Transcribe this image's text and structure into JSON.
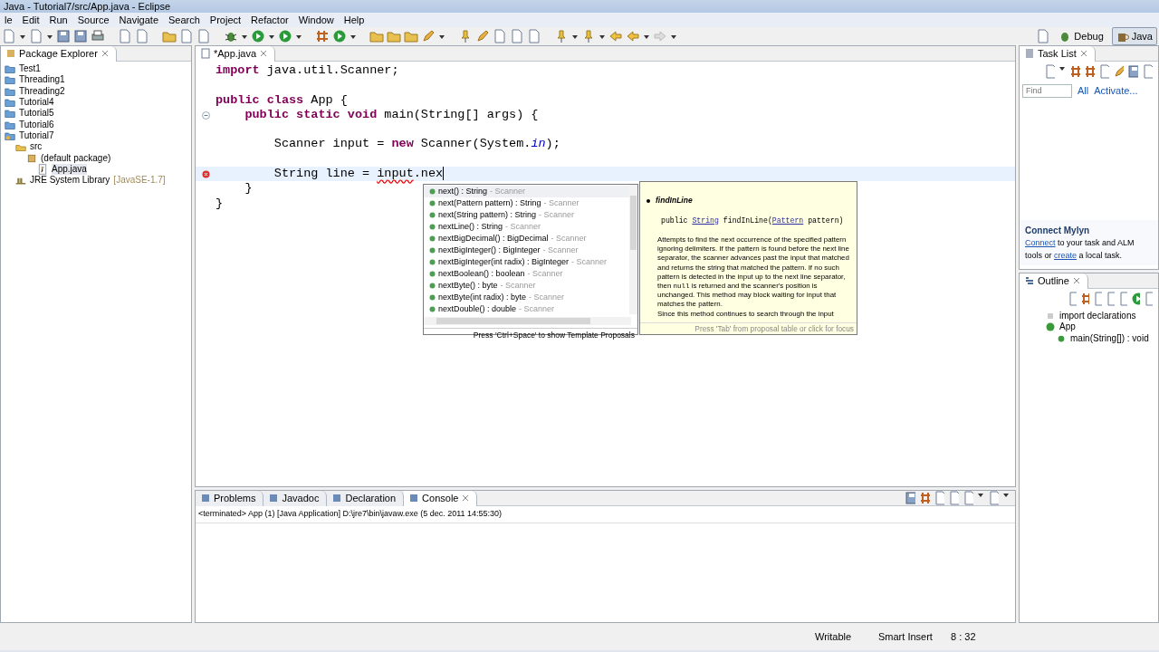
{
  "window": {
    "title": "Java - Tutorial7/src/App.java - Eclipse"
  },
  "menu": [
    "le",
    "Edit",
    "Run",
    "Source",
    "Navigate",
    "Search",
    "Project",
    "Refactor",
    "Window",
    "Help"
  ],
  "perspectives": [
    {
      "label": "Debug",
      "selected": false
    },
    {
      "label": "Java",
      "selected": true
    }
  ],
  "package_explorer": {
    "title": "Package Explorer",
    "tree": [
      {
        "label": "Test1",
        "kind": "project"
      },
      {
        "label": "Threading1",
        "kind": "project"
      },
      {
        "label": "Threading2",
        "kind": "project"
      },
      {
        "label": "Tutorial4",
        "kind": "project"
      },
      {
        "label": "Tutorial5",
        "kind": "project"
      },
      {
        "label": "Tutorial6",
        "kind": "project"
      },
      {
        "label": "Tutorial7",
        "kind": "javaproject",
        "children": [
          {
            "label": "src",
            "kind": "src",
            "children": [
              {
                "label": "(default package)",
                "kind": "package",
                "children": [
                  {
                    "label": "App.java",
                    "kind": "file",
                    "selected": true
                  }
                ]
              }
            ]
          },
          {
            "label": "JRE System Library",
            "decoration": "[JavaSE-1.7]",
            "kind": "library"
          }
        ]
      }
    ]
  },
  "editor": {
    "tab": {
      "label": "*App.java",
      "selected": true
    },
    "lines": [
      {
        "tokens": [
          {
            "text": "import",
            "kind": "keyword"
          },
          {
            "text": " java.util.Scanner;",
            "kind": "plain"
          }
        ]
      },
      {
        "blank": true
      },
      {
        "tokens": [
          {
            "text": "public class",
            "kind": "keyword"
          },
          {
            "text": " App {",
            "kind": "plain"
          }
        ]
      },
      {
        "foldable": true,
        "tokens": [
          {
            "text": "    public static void",
            "kind": "keyword"
          },
          {
            "text": " main(String[] args) {",
            "kind": "plain"
          }
        ]
      },
      {
        "blank": true
      },
      {
        "tokens": [
          {
            "text": "        Scanner input = ",
            "kind": "plain"
          },
          {
            "text": "new",
            "kind": "keyword"
          },
          {
            "text": " Scanner(System.",
            "kind": "plain"
          },
          {
            "text": "in",
            "kind": "static"
          },
          {
            "text": ");",
            "kind": "plain"
          }
        ]
      },
      {
        "blank": true
      },
      {
        "error": true,
        "current": true,
        "cursor": true,
        "tokens": [
          {
            "text": "        String line = ",
            "kind": "plain"
          },
          {
            "text": "input",
            "kind": "error"
          },
          {
            "text": ".nex",
            "kind": "plain"
          }
        ]
      },
      {
        "tokens": [
          {
            "text": "    }",
            "kind": "plain"
          }
        ]
      },
      {
        "tokens": [
          {
            "text": "}",
            "kind": "plain"
          }
        ]
      }
    ]
  },
  "completion": {
    "items": [
      {
        "signature": "next() : String",
        "owner": "- Scanner",
        "selected": true
      },
      {
        "signature": "next(Pattern pattern) : String",
        "owner": "- Scanner",
        "selected": false
      },
      {
        "signature": "next(String pattern) : String",
        "owner": "- Scanner",
        "selected": false
      },
      {
        "signature": "nextLine() : String",
        "owner": "- Scanner",
        "selected": false
      },
      {
        "signature": "nextBigDecimal() : BigDecimal",
        "owner": "- Scanner",
        "selected": false
      },
      {
        "signature": "nextBigInteger() : BigInteger",
        "owner": "- Scanner",
        "selected": false
      },
      {
        "signature": "nextBigInteger(int radix) : BigInteger",
        "owner": "- Scanner",
        "selected": false
      },
      {
        "signature": "nextBoolean() : boolean",
        "owner": "- Scanner",
        "selected": false
      },
      {
        "signature": "nextByte() : byte",
        "owner": "- Scanner",
        "selected": false
      },
      {
        "signature": "nextByte(int radix) : byte",
        "owner": "- Scanner",
        "selected": false
      },
      {
        "signature": "nextDouble() : double",
        "owner": "- Scanner",
        "selected": false
      }
    ],
    "footer": "Press 'Ctrl+Space' to show Template Proposals"
  },
  "javadoc": {
    "title": "findInLine",
    "signature": [
      {
        "text": "public ",
        "link": false
      },
      {
        "text": "String",
        "link": true
      },
      {
        "text": " findInLine(",
        "link": false
      },
      {
        "text": "Pattern",
        "link": true
      },
      {
        "text": " pattern)",
        "link": false
      }
    ],
    "paragraph": [
      {
        "text": "Attempts to find the next occurrence of the specified pattern ignoring delimiters. If the pattern is found before the next line separator, the scanner advances past the input that matched and returns the string that matched the pattern. If no such pattern is detected in the input up to the next line separator, then ",
        "code": false
      },
      {
        "text": "null",
        "code": true
      },
      {
        "text": " is returned and the scanner's position is unchanged. This method may block waiting for input that matches the pattern.",
        "code": false
      }
    ],
    "paragraph_2": "Since this method continues to search through the input",
    "footer": "Press 'Tab' from proposal table or click for focus"
  },
  "task_list": {
    "title": "Task List",
    "find": {
      "placeholder": "Find"
    },
    "links": [
      "All",
      "Activate..."
    ]
  },
  "mylyn": {
    "title": "Connect Mylyn",
    "text": [
      {
        "text": "Connect",
        "link": true
      },
      {
        "text": " to your task and ALM tools or ",
        "link": false
      },
      {
        "text": "create",
        "link": true
      },
      {
        "text": " a local task.",
        "link": false
      }
    ]
  },
  "outline": {
    "title": "Outline",
    "tree": [
      {
        "label": "import declarations",
        "kind": "imports"
      },
      {
        "label": "App",
        "kind": "class",
        "children": [
          {
            "label": "main(String[]) : void",
            "kind": "method"
          }
        ]
      }
    ]
  },
  "bottom_tabs": [
    {
      "label": "Problems",
      "selected": false
    },
    {
      "label": "Javadoc",
      "selected": false
    },
    {
      "label": "Declaration",
      "selected": false
    },
    {
      "label": "Console",
      "selected": true
    }
  ],
  "console": {
    "header": "<terminated> App (1) [Java Application] D:\\jre7\\bin\\javaw.exe (5 dec. 2011 14:55:30)"
  },
  "status_bar": [
    "Writable",
    "Smart Insert",
    "8 : 32"
  ]
}
